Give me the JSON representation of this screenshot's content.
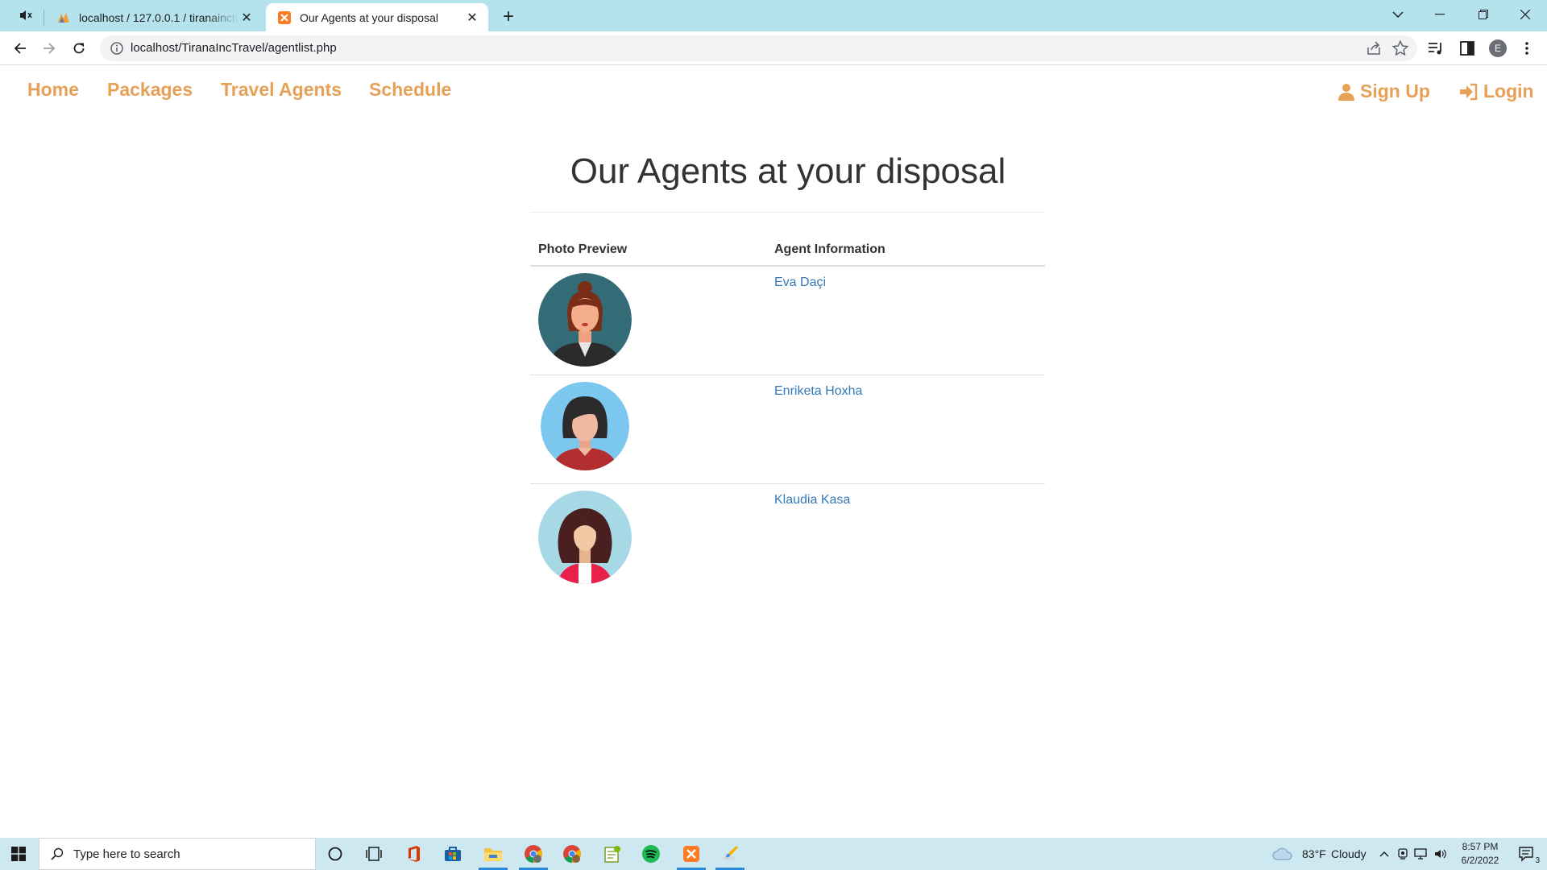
{
  "browser": {
    "tabs": [
      {
        "title": "localhost / 127.0.0.1 / tiranainctravel",
        "active": false
      },
      {
        "title": "Our Agents at your disposal",
        "active": true
      }
    ],
    "url": "localhost/TiranaIncTravel/agentlist.php",
    "profile_initial": "E"
  },
  "site_nav": {
    "home": "Home",
    "packages": "Packages",
    "travel_agents": "Travel Agents",
    "schedule": "Schedule",
    "sign_up": "Sign Up",
    "login": "Login",
    "link_color": "#e6a157"
  },
  "page": {
    "title": "Our Agents at your disposal",
    "table": {
      "headers": [
        "Photo Preview",
        "Agent Information"
      ],
      "rows": [
        {
          "photo": "agent-avatar-business-woman",
          "name": "Eva Daçi"
        },
        {
          "photo": "agent-avatar-woman-dark-hair",
          "name": "Enriketa Hoxha"
        },
        {
          "photo": "agent-avatar-woman-curly-hair",
          "name": "Klaudia Kasa"
        }
      ]
    }
  },
  "taskbar": {
    "search_placeholder": "Type here to search",
    "weather": {
      "temp": "83°F",
      "condition": "Cloudy"
    },
    "clock": {
      "time": "8:57 PM",
      "date": "6/2/2022"
    },
    "notification_count": "3"
  }
}
